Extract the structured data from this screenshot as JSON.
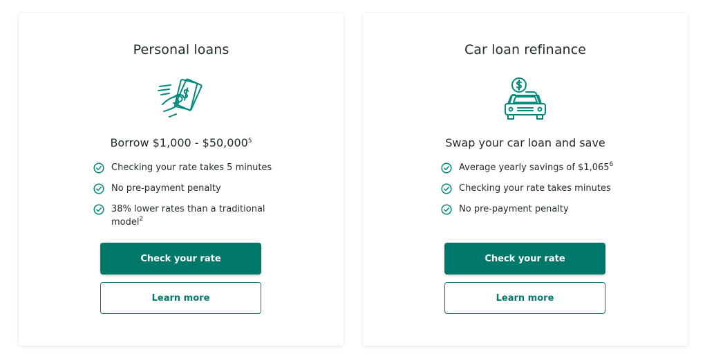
{
  "colors": {
    "accent": "#00796b",
    "text": "#1f2a2e",
    "background": "#ffffff"
  },
  "cards": [
    {
      "title": "Personal loans",
      "icon": "cash-in-hand-icon",
      "subtitle": "Borrow $1,000 - $50,000",
      "subtitle_sup": "5",
      "features": [
        {
          "text": "Checking your rate takes 5 minutes",
          "sup": ""
        },
        {
          "text": "No pre-payment penalty",
          "sup": ""
        },
        {
          "text": "38% lower rates than a traditional model",
          "sup": "2"
        }
      ],
      "primary_button": "Check your rate",
      "secondary_button": "Learn more"
    },
    {
      "title": "Car loan refinance",
      "icon": "car-dollar-icon",
      "subtitle": "Swap your car loan and save",
      "subtitle_sup": "",
      "features": [
        {
          "text": "Average yearly savings of $1,065",
          "sup": "6"
        },
        {
          "text": "Checking your rate takes minutes",
          "sup": ""
        },
        {
          "text": "No pre-payment penalty",
          "sup": ""
        }
      ],
      "primary_button": "Check your rate",
      "secondary_button": "Learn more"
    }
  ]
}
